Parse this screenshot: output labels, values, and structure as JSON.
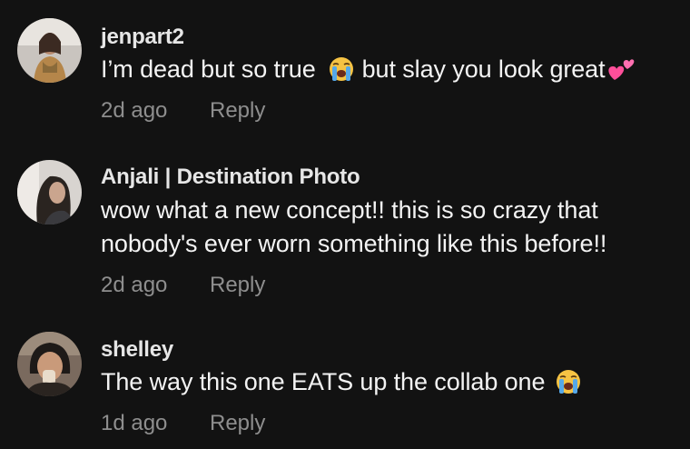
{
  "reply_label": "Reply",
  "comments": [
    {
      "username": "jenpart2",
      "text_part1": "I’m dead but so true",
      "text_part2": "but slay you look great",
      "timestamp": "2d ago",
      "emoji_1": "loudly-crying-face-icon",
      "emoji_2": "two-hearts-icon"
    },
    {
      "username": "Anjali | Destination Photo",
      "text_line1": "wow what a new concept!! this is so crazy that",
      "text_line2": "nobody's ever worn something like this before!!",
      "timestamp": "2d ago"
    },
    {
      "username": "shelley",
      "text_part1": "The way this one EATS up the collab one",
      "timestamp": "1d ago",
      "emoji_1": "loudly-crying-face-icon"
    }
  ],
  "colors": {
    "background": "#121212",
    "text": "#f3f3f3",
    "meta": "#8e8e8e"
  }
}
